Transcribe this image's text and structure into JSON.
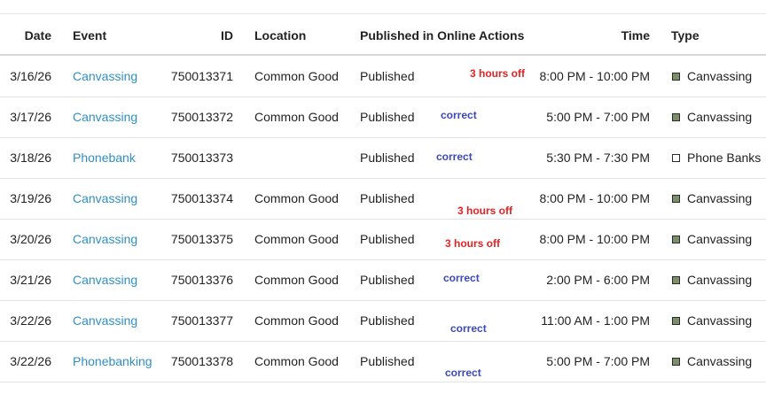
{
  "headers": {
    "date": "Date",
    "event": "Event",
    "id": "ID",
    "location": "Location",
    "published": "Published in Online Actions",
    "time": "Time",
    "type": "Type"
  },
  "colors": {
    "link": "#2f8fc6",
    "canvassing_swatch": "#7b8f6a",
    "phonebank_swatch": "#ffffff",
    "annotation_red": "#e32222",
    "annotation_blue": "#3b48b8"
  },
  "rows": [
    {
      "date": "3/16/26",
      "event": "Canvassing",
      "id": "750013371",
      "location": "Common Good",
      "published": "Published",
      "time": "8:00 PM - 10:00 PM",
      "type": "Canvassing",
      "type_icon": "filled-square-icon",
      "note": "3 hours off",
      "note_color": "red"
    },
    {
      "date": "3/17/26",
      "event": "Canvassing",
      "id": "750013372",
      "location": "Common Good",
      "published": "Published",
      "time": "5:00 PM - 7:00 PM",
      "type": "Canvassing",
      "type_icon": "filled-square-icon",
      "note": "correct",
      "note_color": "blue"
    },
    {
      "date": "3/18/26",
      "event": "Phonebank",
      "id": "750013373",
      "location": "",
      "published": "Published",
      "time": "5:30 PM - 7:30 PM",
      "type": "Phone Banks",
      "type_icon": "empty-square-icon",
      "note": "correct",
      "note_color": "blue"
    },
    {
      "date": "3/19/26",
      "event": "Canvassing",
      "id": "750013374",
      "location": "Common Good",
      "published": "Published",
      "time": "8:00 PM - 10:00 PM",
      "type": "Canvassing",
      "type_icon": "filled-square-icon",
      "note": "3 hours off",
      "note_color": "red"
    },
    {
      "date": "3/20/26",
      "event": "Canvassing",
      "id": "750013375",
      "location": "Common Good",
      "published": "Published",
      "time": "8:00 PM - 10:00 PM",
      "type": "Canvassing",
      "type_icon": "filled-square-icon",
      "note": "3 hours off",
      "note_color": "red"
    },
    {
      "date": "3/21/26",
      "event": "Canvassing",
      "id": "750013376",
      "location": "Common Good",
      "published": "Published",
      "time": "2:00 PM - 6:00 PM",
      "type": "Canvassing",
      "type_icon": "filled-square-icon",
      "note": "correct",
      "note_color": "blue"
    },
    {
      "date": "3/22/26",
      "event": "Canvassing",
      "id": "750013377",
      "location": "Common Good",
      "published": "Published",
      "time": "11:00 AM - 1:00 PM",
      "type": "Canvassing",
      "type_icon": "filled-square-icon",
      "note": "correct",
      "note_color": "blue"
    },
    {
      "date": "3/22/26",
      "event": "Phonebanking",
      "id": "750013378",
      "location": "Common Good",
      "published": "Published",
      "time": "5:00 PM - 7:00 PM",
      "type": "Canvassing",
      "type_icon": "filled-square-icon",
      "note": "correct",
      "note_color": "blue"
    }
  ]
}
